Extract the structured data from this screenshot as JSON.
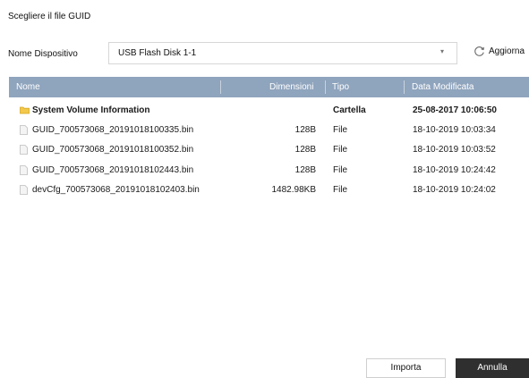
{
  "dialog": {
    "title": "Scegliere il file GUID"
  },
  "device": {
    "label": "Nome Dispositivo",
    "selected": "USB Flash Disk 1-1",
    "refresh_label": "Aggiorna"
  },
  "table": {
    "headers": {
      "name": "Nome",
      "size": "Dimensioni",
      "type": "Tipo",
      "modified": "Data Modificata"
    },
    "rows": [
      {
        "icon": "folder-icon",
        "name": "System Volume Information",
        "size": "",
        "type": "Cartella",
        "modified": "25-08-2017 10:06:50"
      },
      {
        "icon": "file-icon",
        "name": "GUID_700573068_20191018100335.bin",
        "size": "128B",
        "type": "File",
        "modified": "18-10-2019 10:03:34"
      },
      {
        "icon": "file-icon",
        "name": "GUID_700573068_20191018100352.bin",
        "size": "128B",
        "type": "File",
        "modified": "18-10-2019 10:03:52"
      },
      {
        "icon": "file-icon",
        "name": "GUID_700573068_20191018102443.bin",
        "size": "128B",
        "type": "File",
        "modified": "18-10-2019 10:24:42"
      },
      {
        "icon": "file-icon",
        "name": "devCfg_700573068_20191018102403.bin",
        "size": "1482.98KB",
        "type": "File",
        "modified": "18-10-2019 10:24:02"
      }
    ]
  },
  "buttons": {
    "import": "Importa",
    "cancel": "Annulla"
  },
  "colors": {
    "header_bg": "#8fa4bd",
    "folder": "#f2c94c",
    "cancel_bg": "#2f2f2f"
  }
}
